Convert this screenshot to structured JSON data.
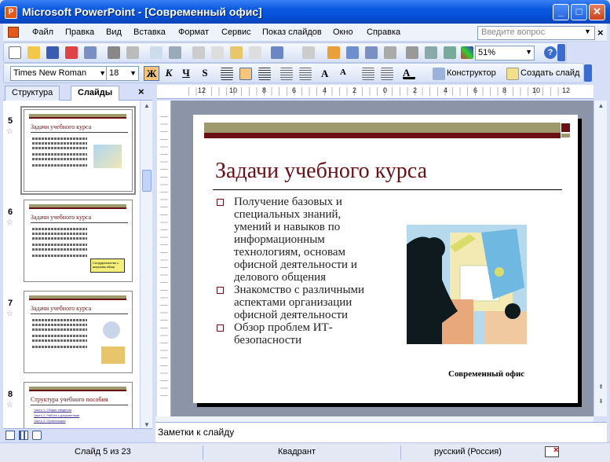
{
  "window": {
    "title": "Microsoft PowerPoint - [Современный офис]",
    "minimize_label": "_",
    "maximize_label": "□",
    "close_label": "✕"
  },
  "menu": {
    "items": [
      "Файл",
      "Правка",
      "Вид",
      "Вставка",
      "Формат",
      "Сервис",
      "Показ слайдов",
      "Окно",
      "Справка"
    ],
    "help_placeholder": "Введите вопрос"
  },
  "standard_toolbar": {
    "zoom": "51%"
  },
  "format_toolbar": {
    "font": "Times New Roman",
    "size": "18",
    "bold": "Ж",
    "italic": "К",
    "underline": "Ч",
    "shadow": "S",
    "design_label": "Конструктор",
    "new_slide_label": "Создать слайд"
  },
  "left_pane": {
    "tabs": [
      "Структура",
      "Слайды"
    ],
    "thumbnails": [
      {
        "number": "5",
        "title": "Задачи учебного курса"
      },
      {
        "number": "6",
        "title": "Задачи учебного курса",
        "note": "Сотрудничество с широким обзор"
      },
      {
        "number": "7",
        "title": "Задачи учебного курса"
      },
      {
        "number": "8",
        "title": "Структура учебного пособия",
        "links": [
          "Часть 1. Общие сведения",
          "Часть 2. Работа с документами",
          "Часть 3. Организация"
        ]
      }
    ]
  },
  "ruler": {
    "labels": [
      "12",
      "10",
      "8",
      "6",
      "4",
      "2",
      "0",
      "2",
      "4",
      "6",
      "8",
      "10",
      "12"
    ]
  },
  "slide": {
    "title": "Задачи учебного курса",
    "bullets": [
      "Получение базовых и специальных знаний, умений и навыков по информационным технологиям, основам офисной деятельности и делового общения",
      "Знакомство с различными аспектами организации офисной деятельности",
      "Обзор проблем ИТ-безопасности"
    ],
    "caption": "Современный офис"
  },
  "notes": {
    "placeholder": "Заметки к слайду"
  },
  "status": {
    "slide": "Слайд 5 из 23",
    "design": "Квадрант",
    "language": "русский (Россия)"
  },
  "colors": {
    "accent": "#6a0f14",
    "olive": "#9f9a6e"
  }
}
